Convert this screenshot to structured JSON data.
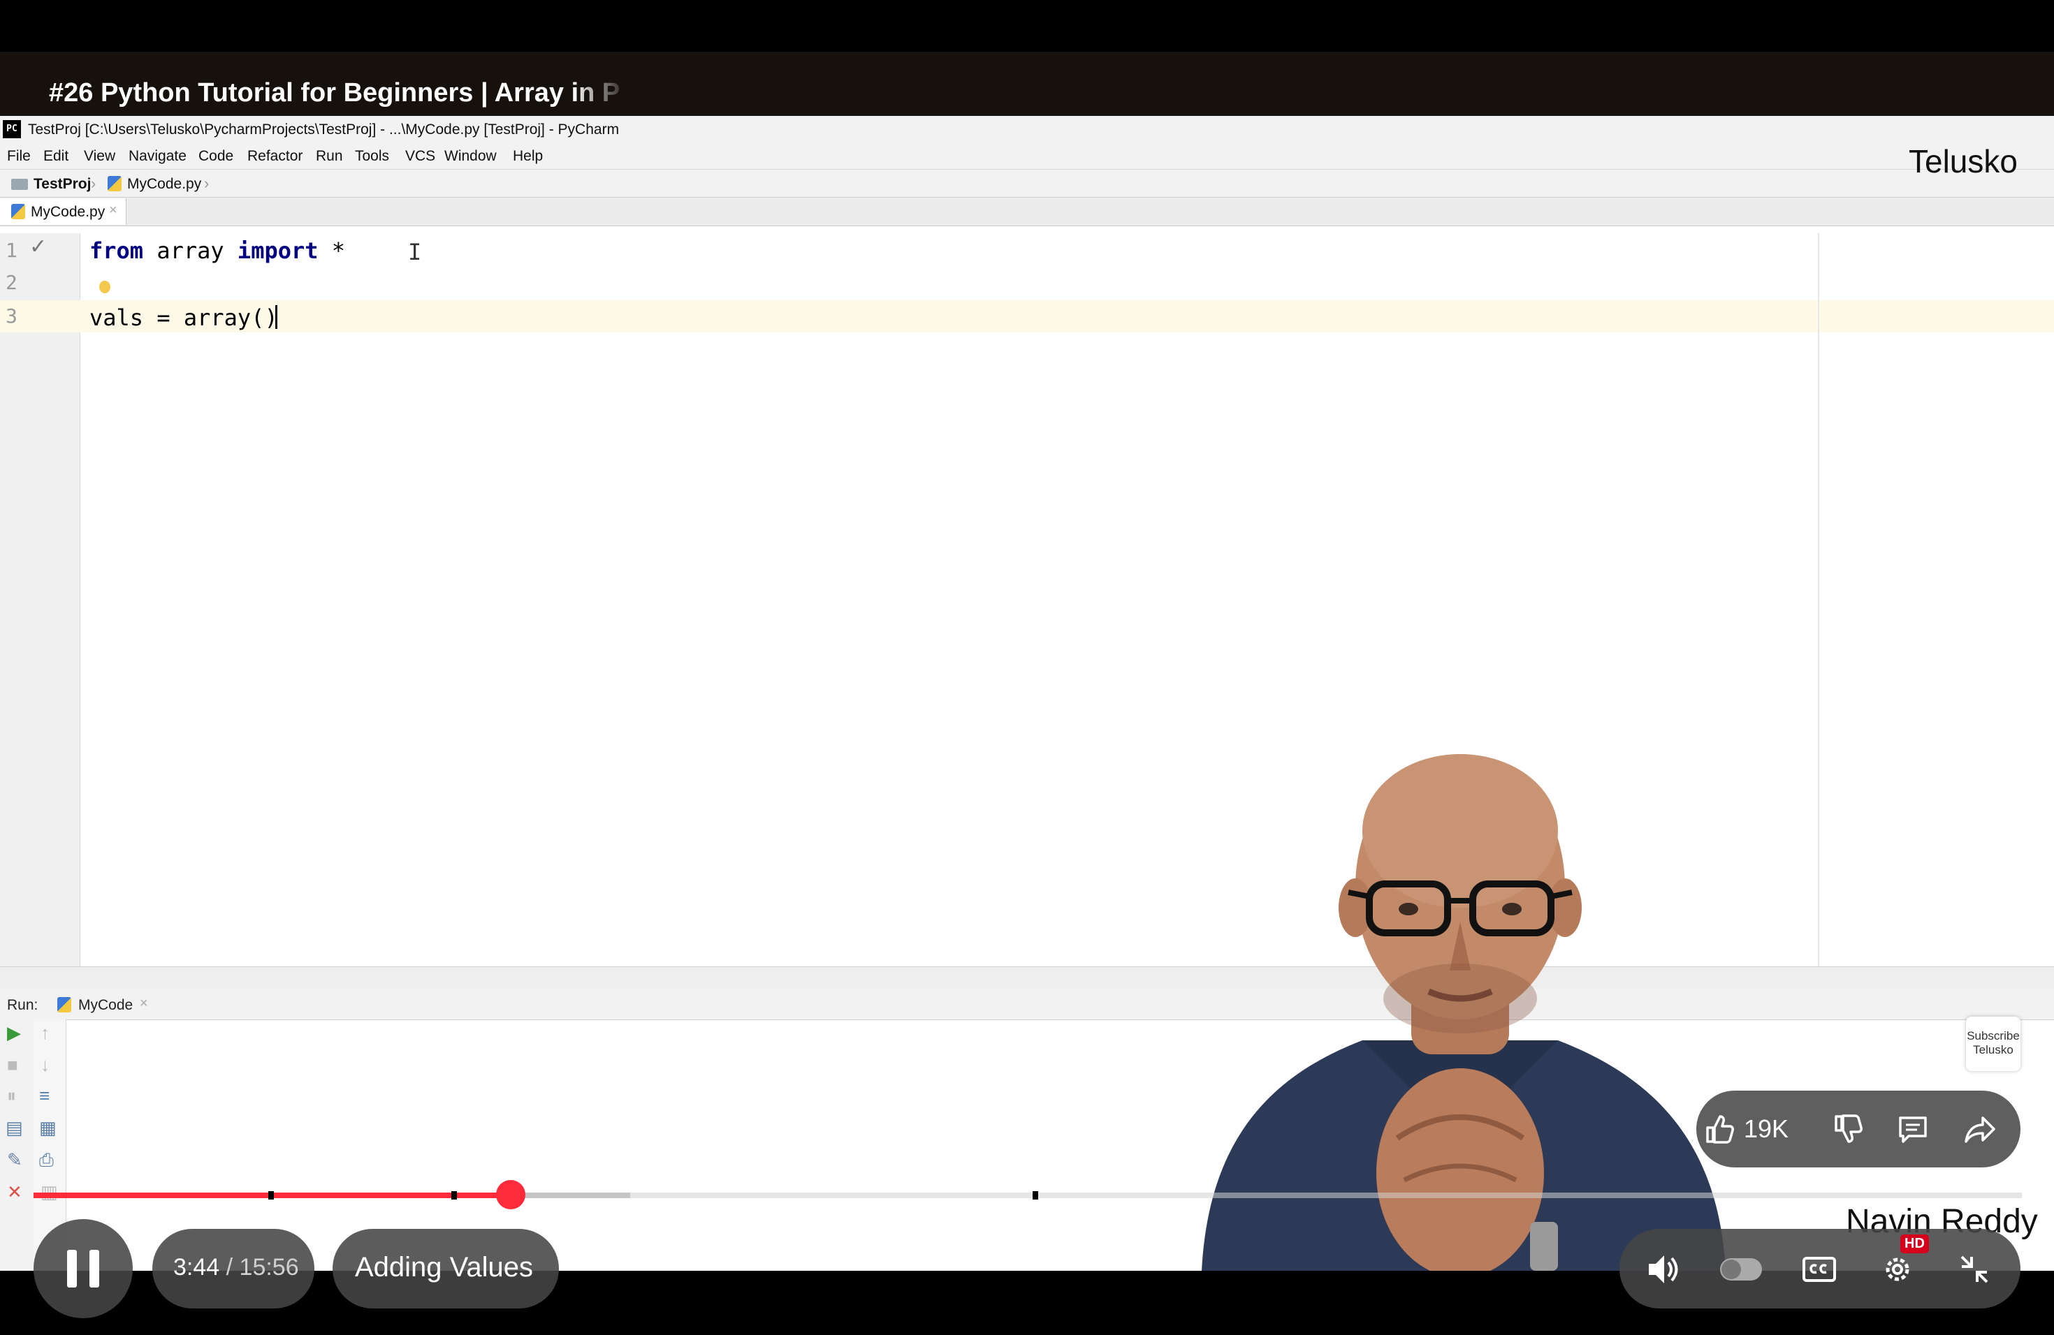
{
  "video": {
    "title": "#26 Python Tutorial for Beginners | Array in P",
    "channel_brand": "Telusko",
    "speaker_name": "Navin Reddy",
    "subscribe_badge": [
      "Subscribe",
      "Telusko"
    ]
  },
  "ide": {
    "window_title": "TestProj [C:\\Users\\Telusko\\PycharmProjects\\TestProj] - ...\\MyCode.py [TestProj] - PyCharm",
    "logo_text": "PC",
    "menu": [
      "File",
      "Edit",
      "View",
      "Navigate",
      "Code",
      "Refactor",
      "Run",
      "Tools",
      "VCS",
      "Window",
      "Help"
    ],
    "breadcrumb": {
      "project": "TestProj",
      "file": "MyCode.py"
    },
    "editor_tab": "MyCode.py",
    "code_lines": [
      {
        "no": "1",
        "text": ""
      },
      {
        "no": "2",
        "text": ""
      },
      {
        "no": "3",
        "text": "vals = array()"
      }
    ],
    "line1": {
      "kw1": "from",
      "mod": " array ",
      "kw2": "import",
      "rest": " *"
    },
    "run_label": "Run:",
    "run_tab": "MyCode"
  },
  "player": {
    "likes": "19K",
    "time_current": "3:44",
    "time_separator": " / ",
    "time_total": "15:56",
    "chapter": "Adding Values",
    "hd_badge": "HD",
    "progress_played_fraction": 0.24,
    "progress_buffered_fraction": 0.3
  },
  "colors": {
    "progress_red": "#ff2a3a",
    "keyword_blue": "#000080"
  },
  "icons": [
    "pause-icon",
    "volume-icon",
    "autoplay-toggle",
    "captions-icon",
    "settings-icon",
    "exit-fullscreen-icon",
    "like-icon",
    "dislike-icon",
    "comment-icon",
    "share-icon"
  ]
}
